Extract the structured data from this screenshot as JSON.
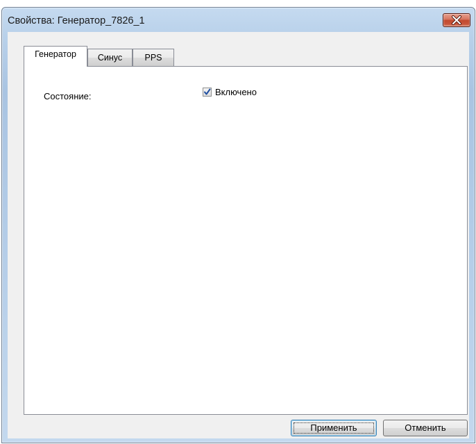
{
  "window": {
    "title": "Свойства: Генератор_7826_1"
  },
  "tabs": [
    {
      "label": "Генератор",
      "active": true
    },
    {
      "label": "Синус",
      "active": false
    },
    {
      "label": "PPS",
      "active": false
    }
  ],
  "panel": {
    "state_label": "Состояние:",
    "enabled_checkbox": {
      "label": "Включено",
      "checked": true
    }
  },
  "buttons": {
    "apply_label": "Применить",
    "cancel_label": "Отменить"
  },
  "icons": {
    "close": "close-icon",
    "checkmark": "checkmark-icon"
  },
  "colors": {
    "close_button": "#c7533a",
    "checkbox_check": "#1f4ea0"
  }
}
